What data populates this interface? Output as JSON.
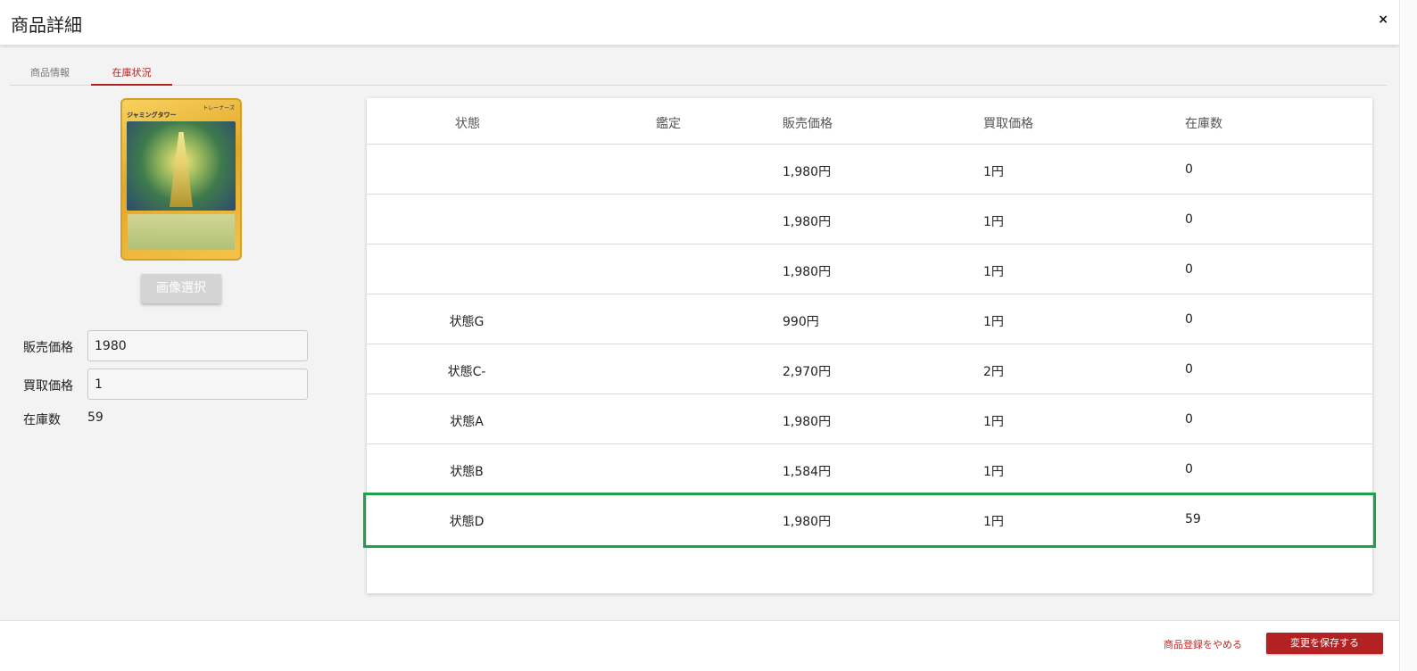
{
  "header": {
    "title": "商品詳細",
    "close_label": "×"
  },
  "tabs": [
    {
      "label": "商品情報",
      "active": false
    },
    {
      "label": "在庫状況",
      "active": true
    }
  ],
  "card": {
    "name": "ジャミングタワー",
    "type": "トレーナーズ"
  },
  "image_button_label": "画像選択",
  "fields": {
    "sell_price_label": "販売価格",
    "sell_price_value": "1980",
    "buy_price_label": "買取価格",
    "buy_price_value": "1",
    "stock_label": "在庫数",
    "stock_value": "59"
  },
  "table": {
    "headers": [
      "状態",
      "鑑定",
      "販売価格",
      "買取価格",
      "在庫数"
    ],
    "rows": [
      {
        "state": "",
        "appraisal": "",
        "sell": "1,980円",
        "buy": "1円",
        "stock": "0"
      },
      {
        "state": "",
        "appraisal": "",
        "sell": "1,980円",
        "buy": "1円",
        "stock": "0"
      },
      {
        "state": "",
        "appraisal": "",
        "sell": "1,980円",
        "buy": "1円",
        "stock": "0"
      },
      {
        "state": "状態G",
        "appraisal": "",
        "sell": "990円",
        "buy": "1円",
        "stock": "0"
      },
      {
        "state": "状態C-",
        "appraisal": "",
        "sell": "2,970円",
        "buy": "2円",
        "stock": "0"
      },
      {
        "state": "状態A",
        "appraisal": "",
        "sell": "1,980円",
        "buy": "1円",
        "stock": "0"
      },
      {
        "state": "状態B",
        "appraisal": "",
        "sell": "1,584円",
        "buy": "1円",
        "stock": "0"
      },
      {
        "state": "状態D",
        "appraisal": "",
        "sell": "1,980円",
        "buy": "1円",
        "stock": "59"
      }
    ],
    "selected_row_index": 7
  },
  "footer": {
    "cancel_label": "商品登録をやめる",
    "save_label": "変更を保存する"
  },
  "colors": {
    "accent": "#b22222",
    "selection": "#1aa34a"
  }
}
